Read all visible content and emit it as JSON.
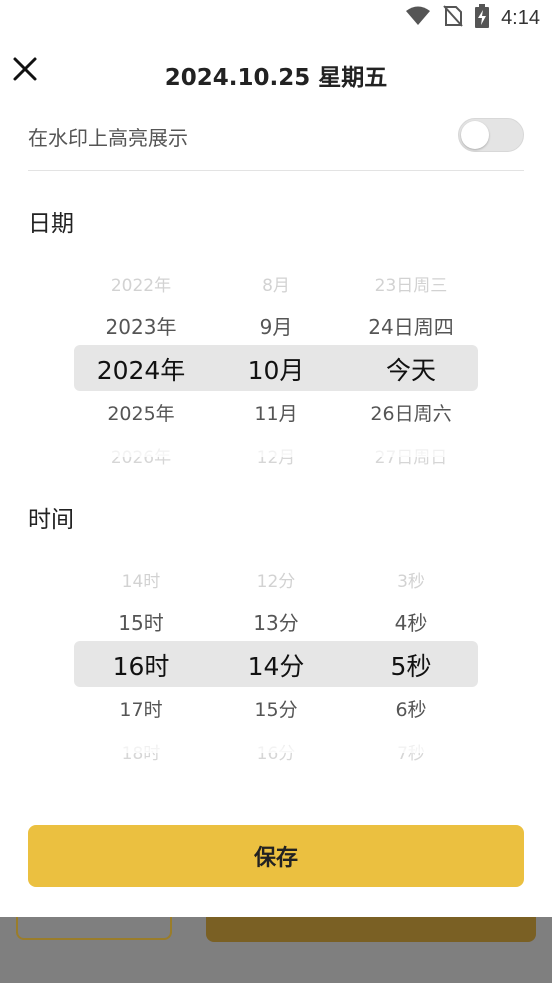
{
  "status_bar": {
    "time": "4:14",
    "icons": [
      "wifi-icon",
      "no-sim-icon",
      "battery-charging-icon"
    ]
  },
  "header": {
    "title": "2024.10.25 星期五",
    "close_icon": "close-icon"
  },
  "watermark_toggle": {
    "label": "在水印上高亮展示",
    "enabled": false
  },
  "date_section": {
    "title": "日期",
    "year_wheel": [
      "2022年",
      "2023年",
      "2024年",
      "2025年",
      "2026年"
    ],
    "month_wheel": [
      "8月",
      "9月",
      "10月",
      "11月",
      "12月"
    ],
    "day_wheel": [
      "23日周三",
      "24日周四",
      "今天",
      "26日周六",
      "27日周日"
    ]
  },
  "time_section": {
    "title": "时间",
    "hour_wheel": [
      "14时",
      "15时",
      "16时",
      "17时",
      "18时"
    ],
    "minute_wheel": [
      "12分",
      "13分",
      "14分",
      "15分",
      "16分"
    ],
    "second_wheel": [
      "3秒",
      "4秒",
      "5秒",
      "6秒",
      "7秒"
    ]
  },
  "save_button": {
    "label": "保存"
  },
  "colors": {
    "accent": "#ebc040",
    "highlight_row": "#e6e6e6"
  }
}
